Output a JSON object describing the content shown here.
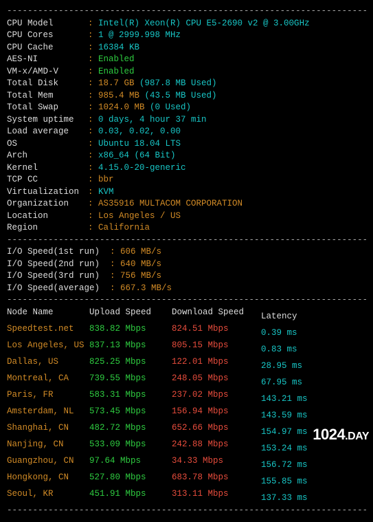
{
  "hr": "----------------------------------------------------------------------",
  "sys": [
    {
      "label": "CPU Model",
      "value": "Intel(R) Xeon(R) CPU E5-2690 v2 @ 3.00GHz",
      "cls": "cyan"
    },
    {
      "label": "CPU Cores",
      "value": "1 @ 2999.998 MHz",
      "cls": "cyan"
    },
    {
      "label": "CPU Cache",
      "value": "16384 KB",
      "cls": "cyan"
    },
    {
      "label": "AES-NI",
      "value": "Enabled",
      "cls": "green"
    },
    {
      "label": "VM-x/AMD-V",
      "value": "Enabled",
      "cls": "green"
    },
    {
      "label": "Total Disk",
      "value": "18.7 GB",
      "extra": "(987.8 MB Used)",
      "cls": "yellow",
      "extraCls": "cyan"
    },
    {
      "label": "Total Mem",
      "value": "985.4 MB",
      "extra": "(43.5 MB Used)",
      "cls": "yellow",
      "extraCls": "cyan"
    },
    {
      "label": "Total Swap",
      "value": "1024.0 MB",
      "extra": "(0 Used)",
      "cls": "yellow",
      "extraCls": "cyan"
    },
    {
      "label": "System uptime",
      "value": "0 days, 4 hour 37 min",
      "cls": "cyan"
    },
    {
      "label": "Load average",
      "value": "0.03, 0.02, 0.00",
      "cls": "cyan"
    },
    {
      "label": "OS",
      "value": "Ubuntu 18.04 LTS",
      "cls": "cyan"
    },
    {
      "label": "Arch",
      "value": "x86_64 (64 Bit)",
      "cls": "cyan"
    },
    {
      "label": "Kernel",
      "value": "4.15.0-20-generic",
      "cls": "cyan"
    },
    {
      "label": "TCP CC",
      "value": "bbr",
      "cls": "yellow"
    },
    {
      "label": "Virtualization",
      "value": "KVM",
      "cls": "cyan"
    },
    {
      "label": "Organization",
      "value": "AS35916 MULTACOM CORPORATION",
      "cls": "yellow"
    },
    {
      "label": "Location",
      "value": "Los Angeles / US",
      "cls": "yellow"
    },
    {
      "label": "Region",
      "value": "California",
      "cls": "yellow"
    }
  ],
  "io": [
    {
      "label": "I/O Speed(1st run)",
      "value": "606 MB/s"
    },
    {
      "label": "I/O Speed(2nd run)",
      "value": "640 MB/s"
    },
    {
      "label": "I/O Speed(3rd run)",
      "value": "756 MB/s"
    },
    {
      "label": "I/O Speed(average)",
      "value": "667.3 MB/s"
    }
  ],
  "headers": {
    "name": "Node Name",
    "up": "Upload Speed",
    "dn": "Download Speed",
    "lat": "Latency"
  },
  "nodes": [
    {
      "name": "Speedtest.net",
      "up": "838.82 Mbps",
      "dn": "824.51 Mbps",
      "lat": "0.39 ms"
    },
    {
      "name": "Los Angeles, US",
      "up": "837.13 Mbps",
      "dn": "805.15 Mbps",
      "lat": "0.83 ms"
    },
    {
      "name": "Dallas, US",
      "up": "825.25 Mbps",
      "dn": "122.01 Mbps",
      "lat": "28.95 ms"
    },
    {
      "name": "Montreal, CA",
      "up": "739.55 Mbps",
      "dn": "248.05 Mbps",
      "lat": "67.95 ms"
    },
    {
      "name": "Paris, FR",
      "up": "583.31 Mbps",
      "dn": "237.02 Mbps",
      "lat": "143.21 ms"
    },
    {
      "name": "Amsterdam, NL",
      "up": "573.45 Mbps",
      "dn": "156.94 Mbps",
      "lat": "143.59 ms"
    },
    {
      "name": "Shanghai, CN",
      "up": "482.72 Mbps",
      "dn": "652.66 Mbps",
      "lat": "154.97 ms"
    },
    {
      "name": "Nanjing, CN",
      "up": "533.09 Mbps",
      "dn": "242.88 Mbps",
      "lat": "153.24 ms"
    },
    {
      "name": "Guangzhou, CN",
      "up": "97.64 Mbps",
      "dn": "34.33 Mbps",
      "lat": "156.72 ms"
    },
    {
      "name": "Hongkong, CN",
      "up": "527.80 Mbps",
      "dn": "683.78 Mbps",
      "lat": "155.85 ms"
    },
    {
      "name": "Seoul, KR",
      "up": "451.91 Mbps",
      "dn": "313.11 Mbps",
      "lat": "137.33 ms"
    }
  ],
  "watermark": {
    "a": "1024",
    "b": ".DAY"
  }
}
